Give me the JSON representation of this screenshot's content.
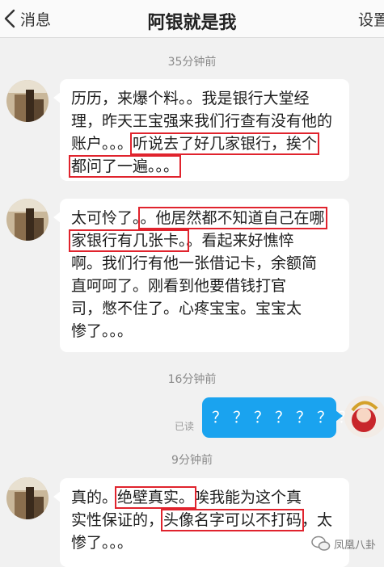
{
  "header": {
    "back_label": "消息",
    "title": "阿银就是我",
    "settings_label": "设置"
  },
  "messages": [
    {
      "time": "35分钟前",
      "lines": [
        [
          {
            "t": "历历，来爆个料。。我是银行大堂经"
          }
        ],
        [
          {
            "t": "理，昨天王宝强来我们行查有没有他的"
          }
        ],
        [
          {
            "t": "账户。。。"
          },
          {
            "t": "听说去了好几家银行，挨个",
            "hl": true
          }
        ],
        [
          {
            "t": "都问了一遍。。。",
            "hl": true
          }
        ]
      ]
    },
    {
      "lines": [
        [
          {
            "t": "太可怜了。"
          },
          {
            "t": "。他居然都不知道自己在哪",
            "hl": true
          }
        ],
        [
          {
            "t": "家银行有几张卡。",
            "hl": true
          },
          {
            "t": "。看起来好憔悴"
          }
        ],
        [
          {
            "t": "啊。我们行有他一张借记卡，余额简"
          }
        ],
        [
          {
            "t": "直呵呵了。刚看到他要借钱打官"
          }
        ],
        [
          {
            "t": "司，憋不住了。心疼宝宝。宝宝太"
          }
        ],
        [
          {
            "t": "惨了。。。"
          }
        ]
      ]
    },
    {
      "time": "16分钟前",
      "read_label": "已读",
      "text": "？？？？？？？"
    },
    {
      "time": "9分钟前",
      "lines": [
        [
          {
            "t": "真的。"
          },
          {
            "t": "绝壁真实。",
            "hl": true
          },
          {
            "t": "唉我能为这个真"
          }
        ],
        [
          {
            "t": "实性保证的，"
          },
          {
            "t": "头像名字可以不打码",
            "hl": true
          },
          {
            "t": "，太"
          }
        ],
        [
          {
            "t": "惨了。。。"
          }
        ]
      ]
    }
  ],
  "watermark": "凤凰八卦"
}
